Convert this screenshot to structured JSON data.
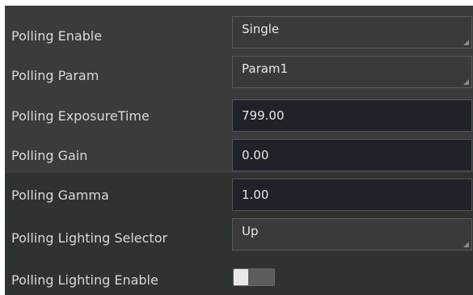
{
  "rows": [
    {
      "label": "Polling Enable",
      "value": "Single"
    },
    {
      "label": "Polling Param",
      "value": "Param1"
    },
    {
      "label": "Polling ExposureTime",
      "value": "799.00"
    },
    {
      "label": "Polling Gain",
      "value": "0.00"
    },
    {
      "label": "Polling Gamma",
      "value": "1.00"
    },
    {
      "label": "Polling Lighting Selector",
      "value": "Up"
    },
    {
      "label": "Polling Lighting Enable",
      "value": ""
    }
  ],
  "toggle": {
    "state": "off"
  },
  "colors": {
    "panel_bg_top": "#3b3b3b",
    "panel_bg_bottom": "#2f3330",
    "input_bg": "#202229",
    "select_bg": "#3a3a3a",
    "text": "#d8d8d8"
  }
}
